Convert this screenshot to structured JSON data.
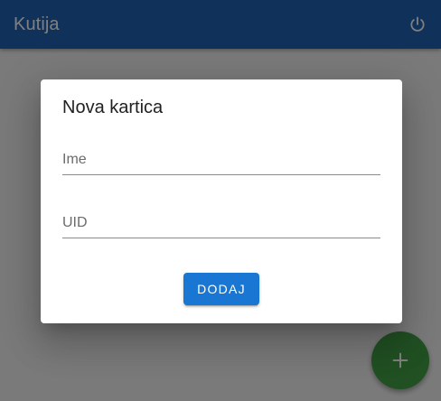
{
  "app_bar": {
    "title": "Kutija",
    "power_icon": "power-icon"
  },
  "fab": {
    "icon": "plus-icon",
    "color": "#43a047"
  },
  "dialog": {
    "title": "Nova kartica",
    "fields": {
      "name": {
        "value": "",
        "placeholder": "Ime"
      },
      "uid": {
        "value": "",
        "placeholder": "UID"
      }
    },
    "add_button_label": "DODAJ"
  },
  "colors": {
    "app_bar": "#1e63b5",
    "primary_button": "#1976d2",
    "fab": "#43a047"
  }
}
